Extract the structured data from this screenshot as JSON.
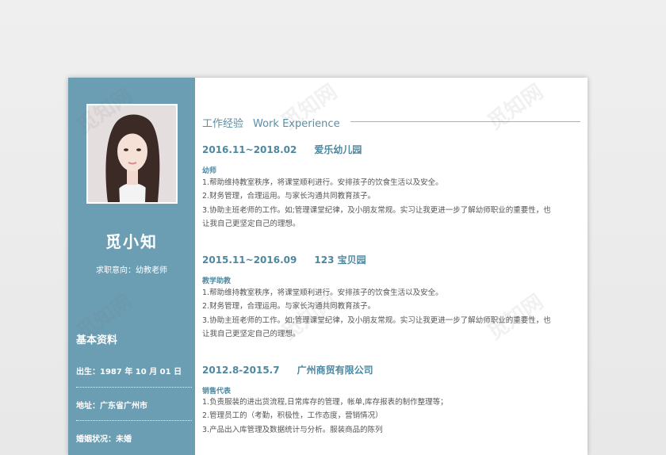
{
  "watermark": "觅知网",
  "profile": {
    "name": "觅小知",
    "intent": "求职意向：幼教老师",
    "basic_title": "基本资料",
    "fields": [
      {
        "label": "出生：",
        "value": "1987 年 10 月 01 日"
      },
      {
        "label": "地址：",
        "value": "广东省广州市"
      },
      {
        "label": "婚姻状况：",
        "value": "未婚"
      }
    ]
  },
  "experience": {
    "title_cn": "工作经验",
    "title_en": "Work Experience",
    "jobs": [
      {
        "period": "2016.11~2018.02",
        "org": "爱乐幼儿园",
        "role": "幼师",
        "duties": [
          "1.帮助维持教室秩序，将课堂顺利进行。安排孩子的饮食生活以及安全。",
          "2.财务管理，合理运用。与家长沟通共同教育孩子。",
          "3.协助主班老师的工作。如;管理课堂纪律，及小朋友常规。实习让我更进一步了解幼师职业的重要性，也",
          "让我自己更坚定自己的理想。"
        ]
      },
      {
        "period": "2015.11~2016.09",
        "org": "123 宝贝园",
        "role": "教学助教",
        "duties": [
          "1.帮助维持教室秩序，将课堂顺利进行。安排孩子的饮食生活以及安全。",
          "2.财务管理，合理运用。与家长沟通共同教育孩子。",
          "3.协助主班老师的工作。如;管理课堂纪律，及小朋友常规。实习让我更进一步了解幼师职业的重要性，也",
          "让我自己更坚定自己的理想。"
        ]
      },
      {
        "period": "2012.8-2015.7",
        "org": "广州商贸有限公司",
        "role": "销售代表",
        "duties": [
          "1.负责服装的进出货流程,日常库存的管理，帐单,库存报表的制作整理等；",
          "2.管理员工的（考勤，积极性，工作态度，营销情况）",
          "3.产品出入库管理及数据统计与分析。服装商品的陈列"
        ]
      }
    ]
  },
  "colors": {
    "sidebar": "#6c9eb3",
    "accent": "#4d88a1"
  }
}
